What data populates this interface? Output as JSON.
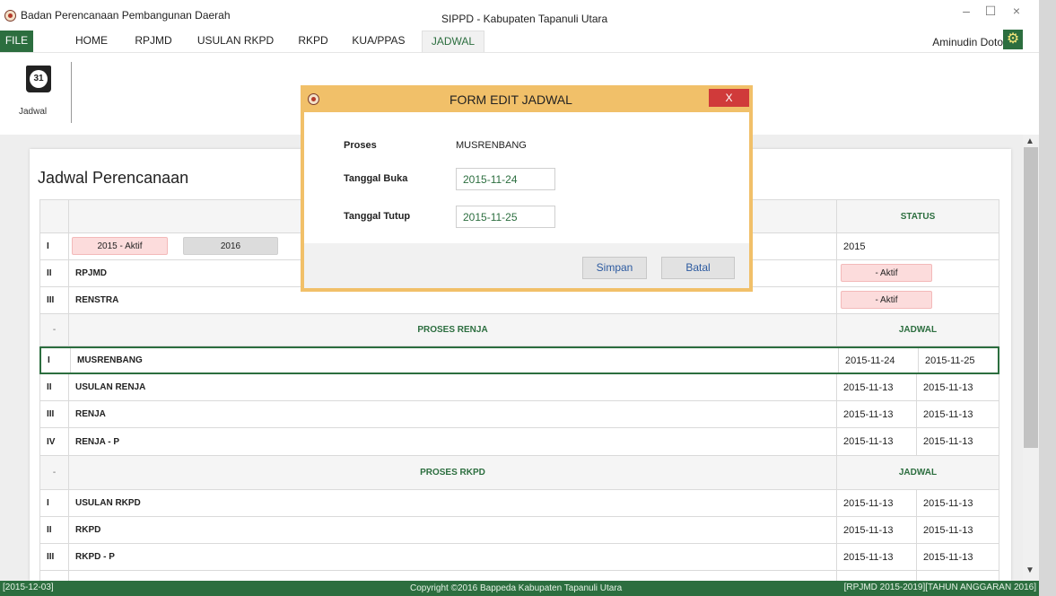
{
  "window": {
    "org_title": "Badan Perencanaan Pembangunan Daerah",
    "app_title": "SIPPD - Kabupaten Tapanuli Utara",
    "minimize": "–",
    "maximize": "☐",
    "close": "×"
  },
  "menu": {
    "items": [
      "FILE",
      "HOME",
      "RPJMD",
      "USULAN RKPD",
      "RKPD",
      "KUA/PPAS",
      "JADWAL"
    ],
    "active": "JADWAL",
    "user": "Aminudin Doto"
  },
  "ribbon": {
    "icon_number": "31",
    "label": "Jadwal"
  },
  "page": {
    "title": "Jadwal Perencanaan"
  },
  "table": {
    "status_header": "STATUS",
    "year_row": {
      "idx": "I",
      "buttons": [
        "2015 - Aktif",
        "2016"
      ],
      "status": "2015"
    },
    "plan_rows": [
      {
        "idx": "II",
        "name": "RPJMD",
        "status": "- Aktif"
      },
      {
        "idx": "III",
        "name": "RENSTRA",
        "status": "- Aktif"
      }
    ],
    "renja": {
      "idx": "-",
      "title": "PROSES RENJA",
      "col": "JADWAL",
      "rows": [
        {
          "idx": "I",
          "name": "MUSRENBANG",
          "open": "2015-11-24",
          "close": "2015-11-25"
        },
        {
          "idx": "II",
          "name": "USULAN RENJA",
          "open": "2015-11-13",
          "close": "2015-11-13"
        },
        {
          "idx": "III",
          "name": "RENJA",
          "open": "2015-11-13",
          "close": "2015-11-13"
        },
        {
          "idx": "IV",
          "name": "RENJA - P",
          "open": "2015-11-13",
          "close": "2015-11-13"
        }
      ]
    },
    "rkpd": {
      "idx": "-",
      "title": "PROSES RKPD",
      "col": "JADWAL",
      "rows": [
        {
          "idx": "I",
          "name": "USULAN RKPD",
          "open": "2015-11-13",
          "close": "2015-11-13"
        },
        {
          "idx": "II",
          "name": "RKPD",
          "open": "2015-11-13",
          "close": "2015-11-13"
        },
        {
          "idx": "III",
          "name": "RKPD - P",
          "open": "2015-11-13",
          "close": "2015-11-13"
        }
      ]
    }
  },
  "modal": {
    "title": "FORM EDIT JADWAL",
    "close": "X",
    "proses_label": "Proses",
    "proses_value": "MUSRENBANG",
    "buka_label": "Tanggal Buka",
    "buka_value": "2015-11-24",
    "tutup_label": "Tanggal Tutup",
    "tutup_value": "2015-11-25",
    "save": "Simpan",
    "cancel": "Batal"
  },
  "statusbar": {
    "date": "[2015-12-03]",
    "copyright": "Copyright ©2016 Bappeda Kabupaten Tapanuli Utara",
    "period": "[RPJMD 2015-2019][TAHUN ANGGARAN 2016]"
  },
  "colors": {
    "brand_green": "#2c6e3f",
    "modal_gold": "#f1c069",
    "close_red": "#d03a3a",
    "pill_pink": "#fcdcdc"
  }
}
